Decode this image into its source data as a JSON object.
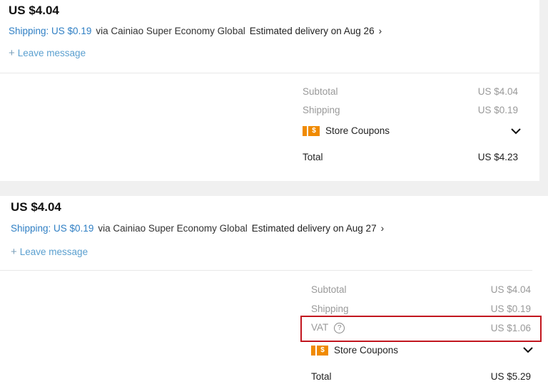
{
  "orders": [
    {
      "price": "US $4.04",
      "shipping_label": "Shipping: US $0.19",
      "carrier": "via Cainiao Super Economy Global",
      "estimated_delivery": "Estimated delivery on Aug 26",
      "leave_message": "Leave message",
      "summary": {
        "subtotal_label": "Subtotal",
        "subtotal_value": "US $4.04",
        "shipping_label": "Shipping",
        "shipping_value": "US $0.19",
        "coupons_label": "Store Coupons",
        "total_label": "Total",
        "total_value": "US $4.23"
      }
    },
    {
      "price": "US $4.04",
      "shipping_label": "Shipping: US $0.19",
      "carrier": "via Cainiao Super Economy Global",
      "estimated_delivery": "Estimated delivery on Aug 27",
      "leave_message": "Leave message",
      "summary": {
        "subtotal_label": "Subtotal",
        "subtotal_value": "US $4.04",
        "shipping_label": "Shipping",
        "shipping_value": "US $0.19",
        "vat_label": "VAT",
        "vat_value": "US $1.06",
        "coupons_label": "Store Coupons",
        "total_label": "Total",
        "total_value": "US $5.29"
      }
    }
  ],
  "icons": {
    "coupon_glyph": "$",
    "help_glyph": "?",
    "chevron_right": "›"
  },
  "colors": {
    "link": "#2f7fc4",
    "coupon": "#f08a00",
    "highlight_box": "#c2161f"
  }
}
